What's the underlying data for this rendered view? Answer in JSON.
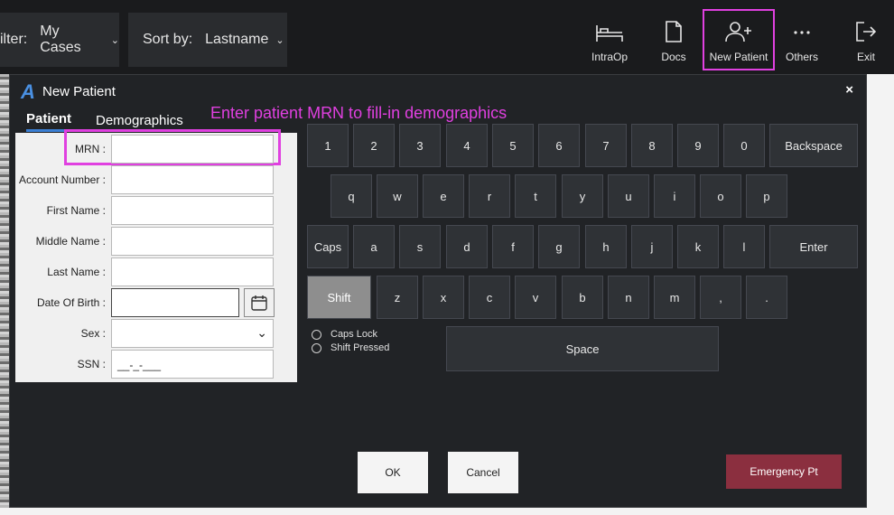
{
  "header": {
    "filter_label": "ilter:",
    "filter_value": "My Cases",
    "sort_label": "Sort by:",
    "sort_value": "Lastname",
    "toolbar": [
      {
        "label": "IntraOp",
        "icon": "bed-icon"
      },
      {
        "label": "Docs",
        "icon": "document-icon"
      },
      {
        "label": "New Patient",
        "icon": "add-user-icon"
      },
      {
        "label": "Others",
        "icon": "more-icon"
      },
      {
        "label": "Exit",
        "icon": "exit-icon"
      }
    ]
  },
  "dialog": {
    "logo": "A",
    "title": "New Patient",
    "close": "×",
    "tabs": [
      "Patient",
      "Demographics"
    ],
    "hint": "Enter patient MRN to fill-in demographics",
    "fields": [
      {
        "label": "MRN :",
        "value": ""
      },
      {
        "label": "Account Number :",
        "value": ""
      },
      {
        "label": "First Name :",
        "value": ""
      },
      {
        "label": "Middle Name :",
        "value": ""
      },
      {
        "label": "Last Name :",
        "value": ""
      },
      {
        "label": "Date Of Birth :",
        "value": ""
      },
      {
        "label": "Sex :",
        "value": ""
      },
      {
        "label": "SSN :",
        "value": "__-_-___"
      }
    ],
    "keyboard": {
      "row1": [
        "1",
        "2",
        "3",
        "4",
        "5",
        "6",
        "7",
        "8",
        "9",
        "0",
        "Backspace"
      ],
      "row2": [
        "q",
        "w",
        "e",
        "r",
        "t",
        "y",
        "u",
        "i",
        "o",
        "p"
      ],
      "row3": [
        "Caps",
        "a",
        "s",
        "d",
        "f",
        "g",
        "h",
        "j",
        "k",
        "l",
        "Enter"
      ],
      "row4": [
        "Shift",
        "z",
        "x",
        "c",
        "v",
        "b",
        "n",
        "m",
        ",",
        "."
      ],
      "space": "Space",
      "caps_lock": "Caps Lock",
      "shift_pressed": "Shift Pressed"
    },
    "buttons": {
      "ok": "OK",
      "cancel": "Cancel",
      "emergency": "Emergency Pt"
    }
  }
}
